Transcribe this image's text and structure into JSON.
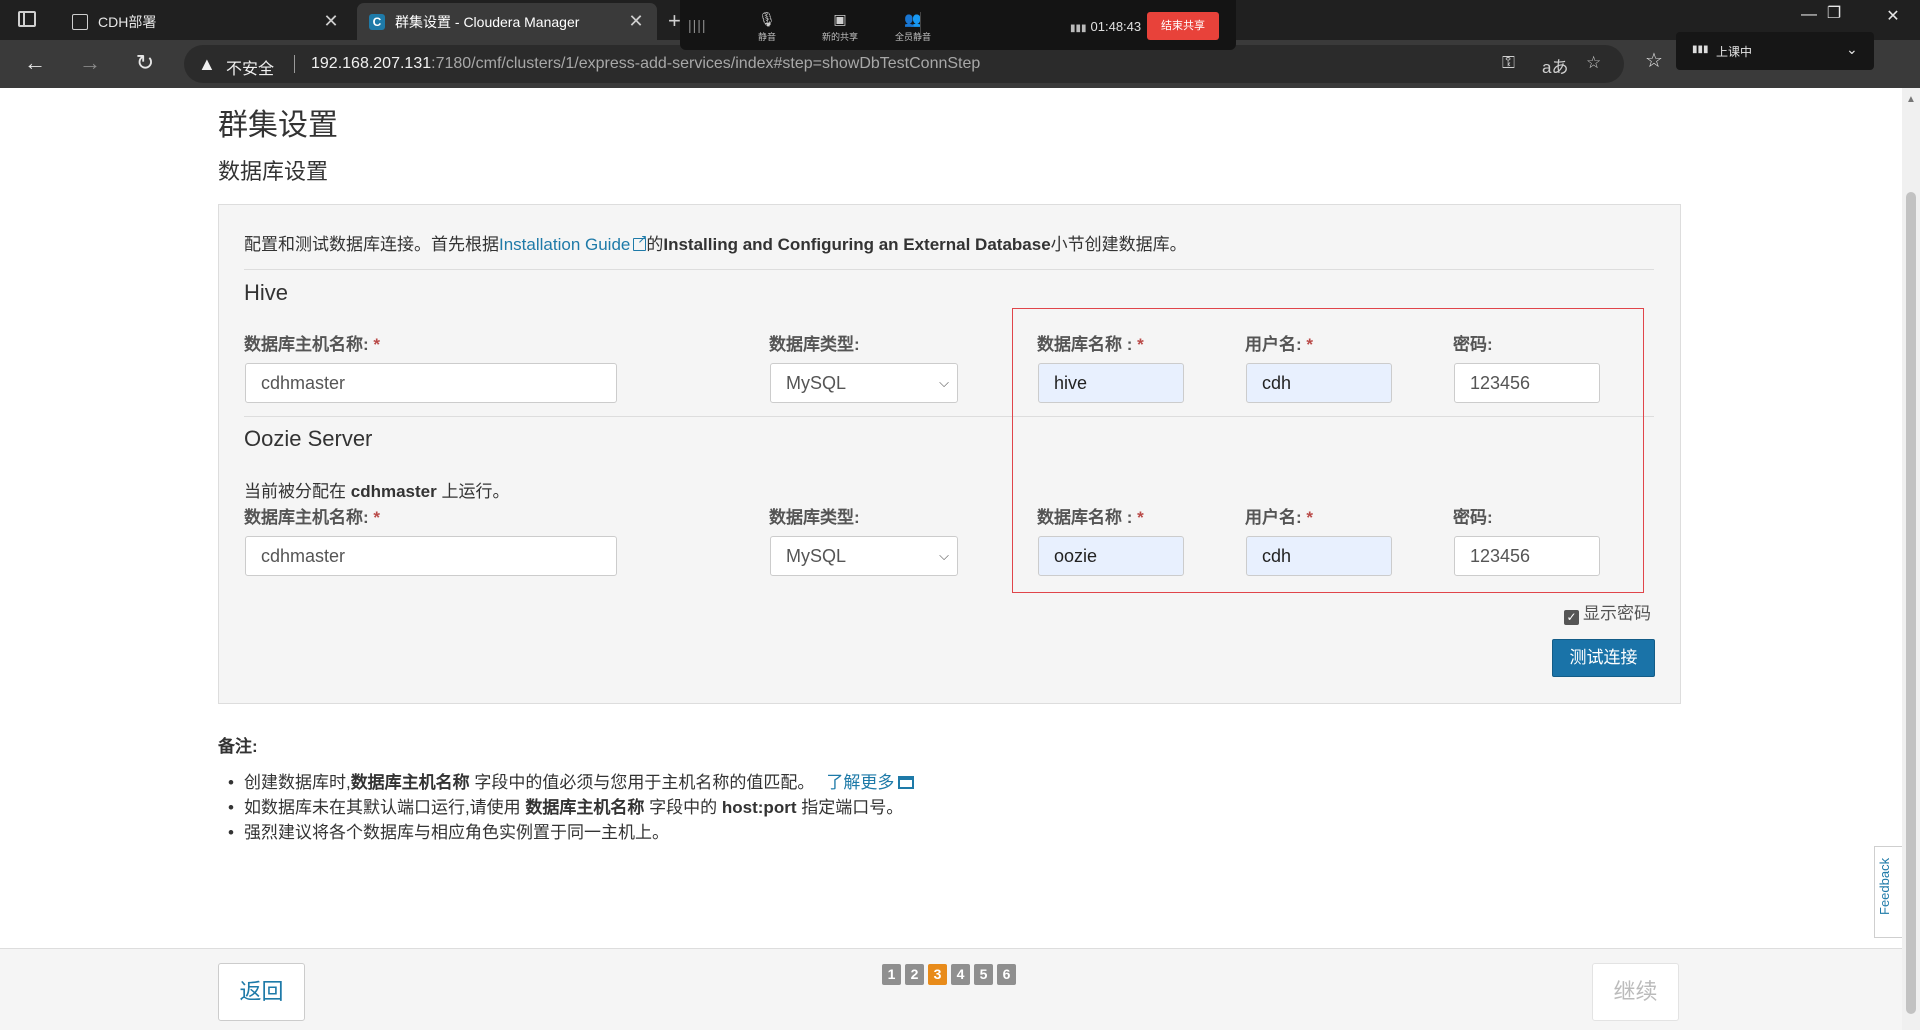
{
  "browser": {
    "tabs": [
      {
        "label": "CDH部署",
        "close": "✕"
      },
      {
        "label": "群集设置 - Cloudera Manager",
        "favicon": "C",
        "close": "✕"
      }
    ],
    "new_tab": "+",
    "address": {
      "security": "不安全",
      "url_host": "192.168.207.131",
      "url_rest": ":7180/cmf/clusters/1/express-add-services/index#step=showDbTestConnStep"
    },
    "window_controls": {
      "minimize": "—",
      "restore": "❐",
      "close": "✕"
    },
    "overlay_status": "上课中"
  },
  "meeting_bar": {
    "mute_label": "静音",
    "share_label": "新的共享",
    "mute_all_label": "全员静音",
    "timer": "01:48:43",
    "end_share_label": "结束共享"
  },
  "page": {
    "title": "群集设置",
    "section": "数据库设置",
    "intro": {
      "prefix": "配置和测试数据库连接。首先根据",
      "link": "Installation Guide",
      "middle": "的",
      "bold": "Installing and Configuring an External Database",
      "suffix": "小节创建数据库。"
    },
    "labels": {
      "db_host": "数据库主机名称:",
      "db_type": "数据库类型:",
      "db_name": "数据库名称 :",
      "username": "用户名:",
      "password": "密码:",
      "required": "*"
    },
    "services": [
      {
        "name": "Hive",
        "host": "cdhmaster",
        "type": "MySQL",
        "db_name": "hive",
        "username": "cdh",
        "password": "123456"
      },
      {
        "name": "Oozie Server",
        "host": "cdhmaster",
        "type": "MySQL",
        "db_name": "oozie",
        "username": "cdh",
        "password": "123456",
        "assigned_prefix": "当前被分配在",
        "assigned_host": "cdhmaster",
        "assigned_suffix": "上运行。"
      }
    ],
    "show_password": {
      "label": "显示密码",
      "checked": true
    },
    "test_button": "测试连接",
    "notes": {
      "title": "备注:",
      "items": [
        {
          "p1": "创建数据库时,",
          "b1": "数据库主机名称",
          "p2": "字段中的值必须与您用于主机名称的值匹配。",
          "link": "了解更多"
        },
        {
          "p1": "如数据库未在其默认端口运行,请使用",
          "b1": "数据库主机名称",
          "p2": "字段中的",
          "b2": "host:port",
          "p3": "指定端口号。"
        },
        {
          "p1": "强烈建议将各个数据库与相应角色实例置于同一主机上。"
        }
      ]
    }
  },
  "footer": {
    "back": "返回",
    "steps": [
      "1",
      "2",
      "3",
      "4",
      "5",
      "6"
    ],
    "active_step": 3,
    "next": "继续"
  },
  "feedback": "Feedback",
  "colors": {
    "link": "#1e7aa8",
    "primary_button": "#1a73a8",
    "active_step": "#e88b1a",
    "highlight_box": "#e0454a"
  }
}
